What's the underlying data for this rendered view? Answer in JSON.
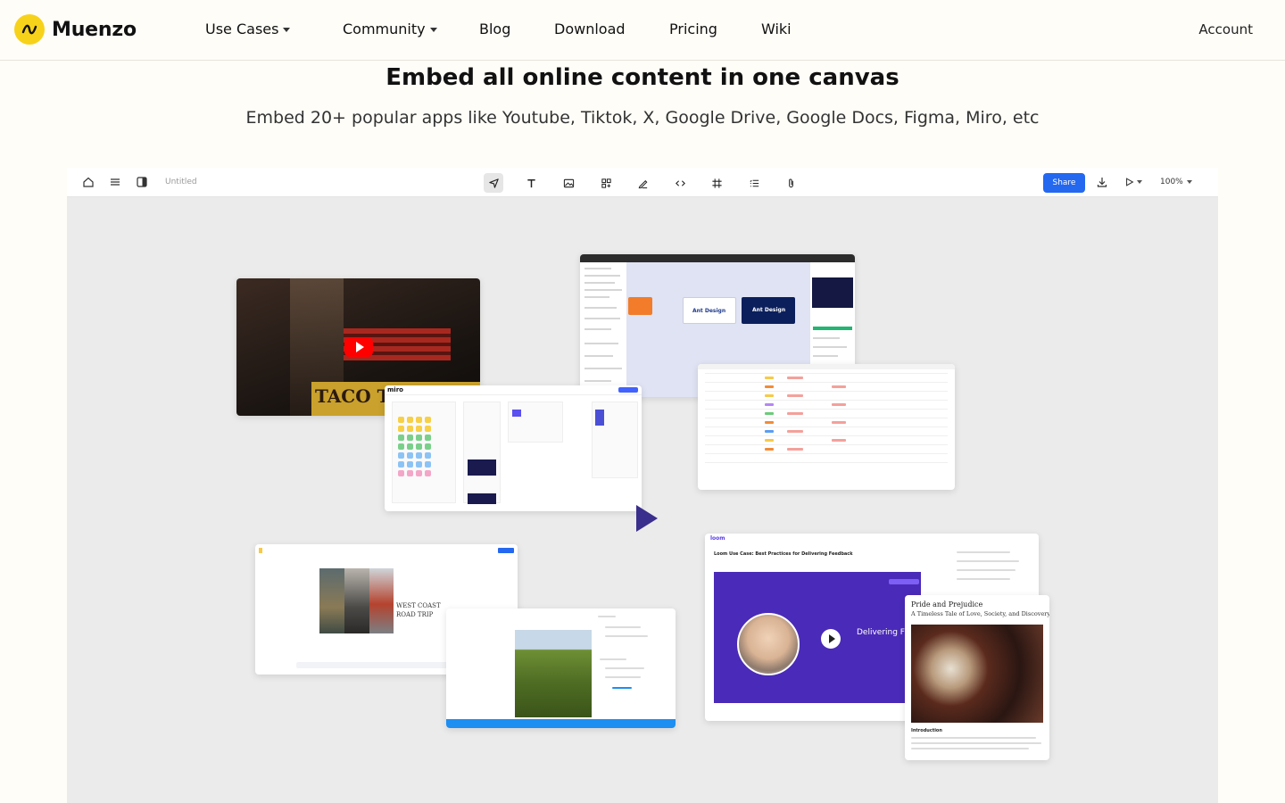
{
  "header": {
    "brand": "Muenzo",
    "nav": [
      {
        "label": "Use Cases",
        "dropdown": true
      },
      {
        "label": "Community",
        "dropdown": true
      },
      {
        "label": "Blog",
        "dropdown": false
      },
      {
        "label": "Download",
        "dropdown": false
      },
      {
        "label": "Pricing",
        "dropdown": false
      },
      {
        "label": "Wiki",
        "dropdown": false
      }
    ],
    "account": "Account"
  },
  "hero": {
    "title": "Embed all online content in one canvas",
    "subtitle": "Embed 20+ popular apps like Youtube, Tiktok, X, Google Drive, Google Docs, Figma, Miro, etc"
  },
  "app": {
    "doc_title": "Untitled",
    "share_label": "Share",
    "zoom": "100%",
    "tools": [
      "select-icon",
      "text-icon",
      "image-icon",
      "widgets-icon",
      "pen-icon",
      "code-icon",
      "frame-icon",
      "list-icon",
      "attachment-icon"
    ],
    "accent": "#2468f0"
  },
  "cards": {
    "youtube": {
      "sign_text": "TACO TACO C"
    },
    "figma": {
      "label_1": "Ant Design",
      "label_2": "Ant Design"
    },
    "miro": {
      "brand": "miro"
    },
    "photo": {
      "caption_1": "WEST COAST",
      "caption_2": "ROAD TRIP"
    },
    "loom": {
      "brand": "loom",
      "title": "Loom Use Case: Best Practices for Delivering Feedback",
      "overlay": "Delivering Fee"
    },
    "book": {
      "title": "Pride and Prejudice",
      "subtitle": "A Timeless Tale of Love, Society, and Discovery",
      "intro": "Introduction"
    }
  }
}
